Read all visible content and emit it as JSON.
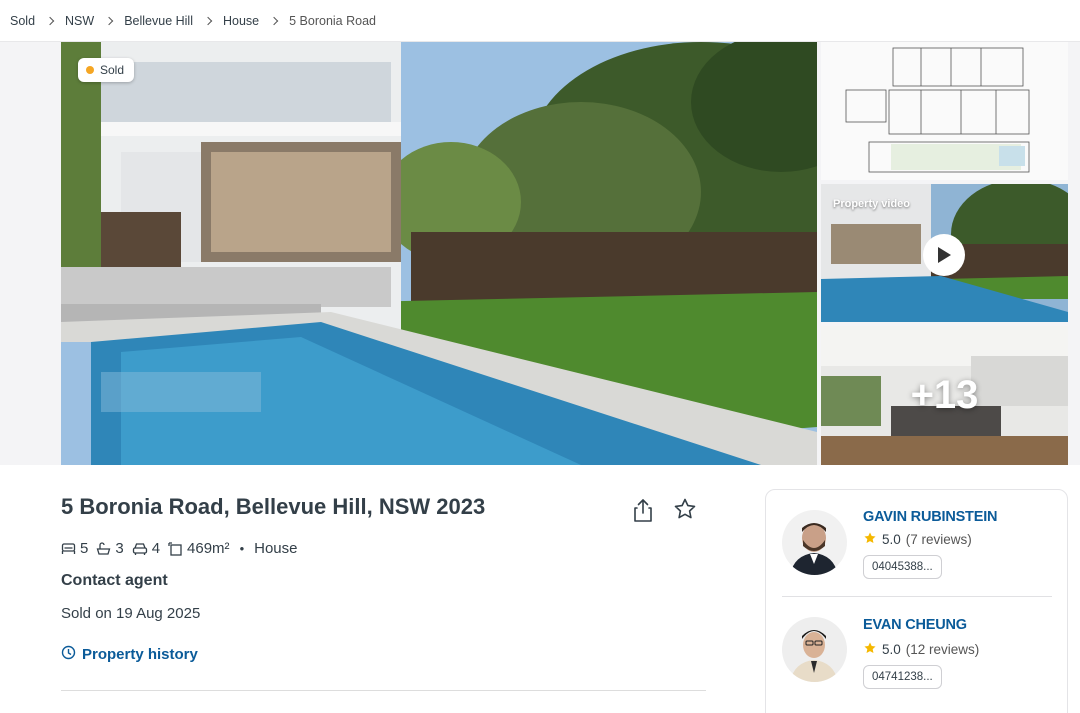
{
  "breadcrumb": [
    {
      "label": "Sold"
    },
    {
      "label": "NSW"
    },
    {
      "label": "Bellevue Hill"
    },
    {
      "label": "House"
    },
    {
      "label": "5 Boronia Road"
    }
  ],
  "gallery": {
    "status_badge": "Sold",
    "status_color": "#f5a623",
    "video_label": "Property video",
    "more_photos": "+13"
  },
  "listing": {
    "address": "5 Boronia Road, Bellevue Hill, NSW 2023",
    "bedrooms": "5",
    "bathrooms": "3",
    "parking": "4",
    "land_size": "469m²",
    "property_type": "House",
    "price": "Contact agent",
    "sold_date": "Sold on 19 Aug 2025",
    "history_link": "Property history",
    "icons": {
      "share": "share-icon",
      "save": "star-icon",
      "bed": "bed-icon",
      "bath": "bath-icon",
      "car": "car-icon",
      "land": "land-size-icon",
      "history": "clock-icon"
    }
  },
  "agents": [
    {
      "name": "GAVIN RUBINSTEIN",
      "rating": "5.0",
      "reviews": "(7 reviews)",
      "phone": "04045388..."
    },
    {
      "name": "EVAN CHEUNG",
      "rating": "5.0",
      "reviews": "(12 reviews)",
      "phone": "04741238..."
    }
  ],
  "colors": {
    "link": "#0b5b99",
    "text": "#333f48",
    "star": "#f5b800"
  }
}
